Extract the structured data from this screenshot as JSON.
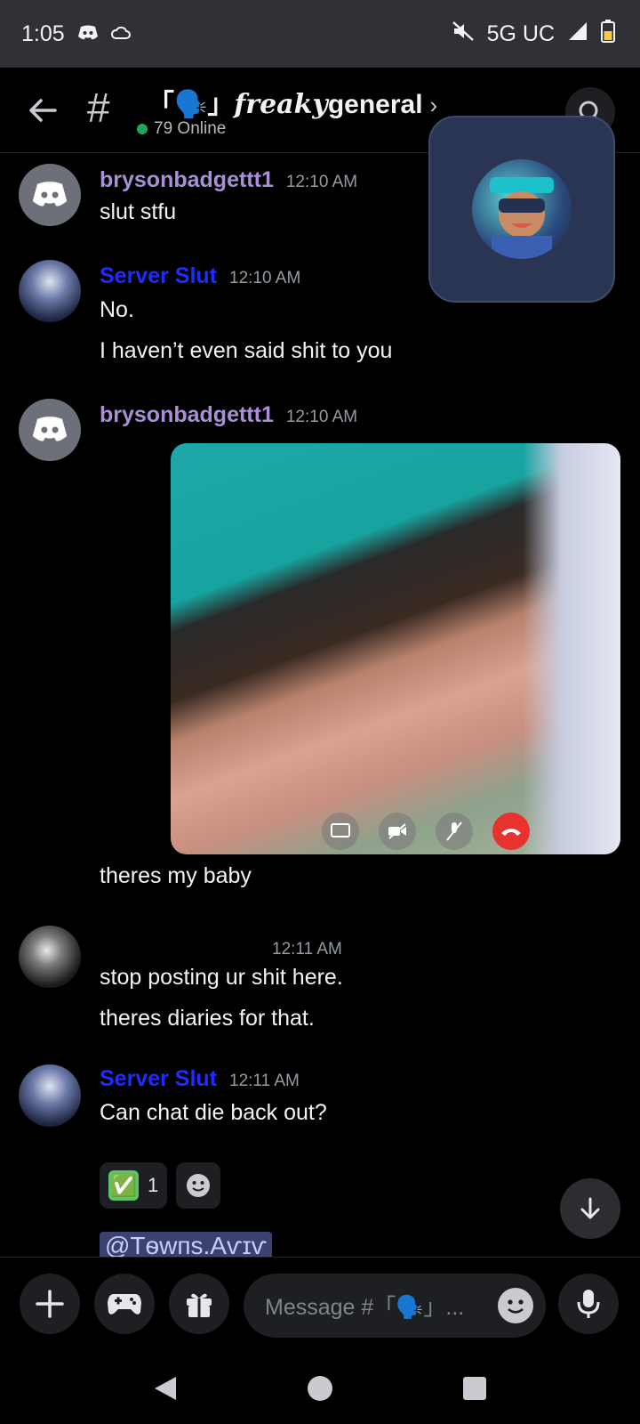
{
  "status_bar": {
    "time": "1:05",
    "network": "5G UC"
  },
  "header": {
    "channel_name_prefix": "「🗣️」",
    "channel_name_fancy": "freaky",
    "channel_name_suffix": "general",
    "online_count": "79 Online"
  },
  "messages": [
    {
      "author": "brysonbadgettt1",
      "time": "12:10 AM",
      "lines": [
        "slut stfu"
      ]
    },
    {
      "author": "Server Slut",
      "time": "12:10 AM",
      "lines": [
        "No.",
        "I haven’t even said shit to you"
      ]
    },
    {
      "author": "brysonbadgettt1",
      "time": "12:10 AM",
      "lines": [
        "theres my baby"
      ]
    },
    {
      "author": "",
      "time": "12:11 AM",
      "lines": [
        "stop posting ur shit here.",
        "theres diaries for that."
      ]
    },
    {
      "author": "Server Slut",
      "time": "12:11 AM",
      "lines": [
        "Can chat die back out?"
      ]
    }
  ],
  "reaction": {
    "emoji": "✅",
    "count": "1"
  },
  "mention_text": "@Tѳwпs.Aѵɪѵ",
  "composer": {
    "placeholder": "Message #「🗣️」..."
  },
  "colors": {
    "purple_name": "#a98fd6",
    "blue_name": "#1d2dff",
    "online_green": "#23a55a",
    "end_call_red": "#e8322e"
  },
  "icons": [
    "back-arrow-icon",
    "hash-icon",
    "search-icon",
    "plus-icon",
    "gamepad-icon",
    "gift-icon",
    "emoji-icon",
    "microphone-icon",
    "scroll-down-icon"
  ]
}
